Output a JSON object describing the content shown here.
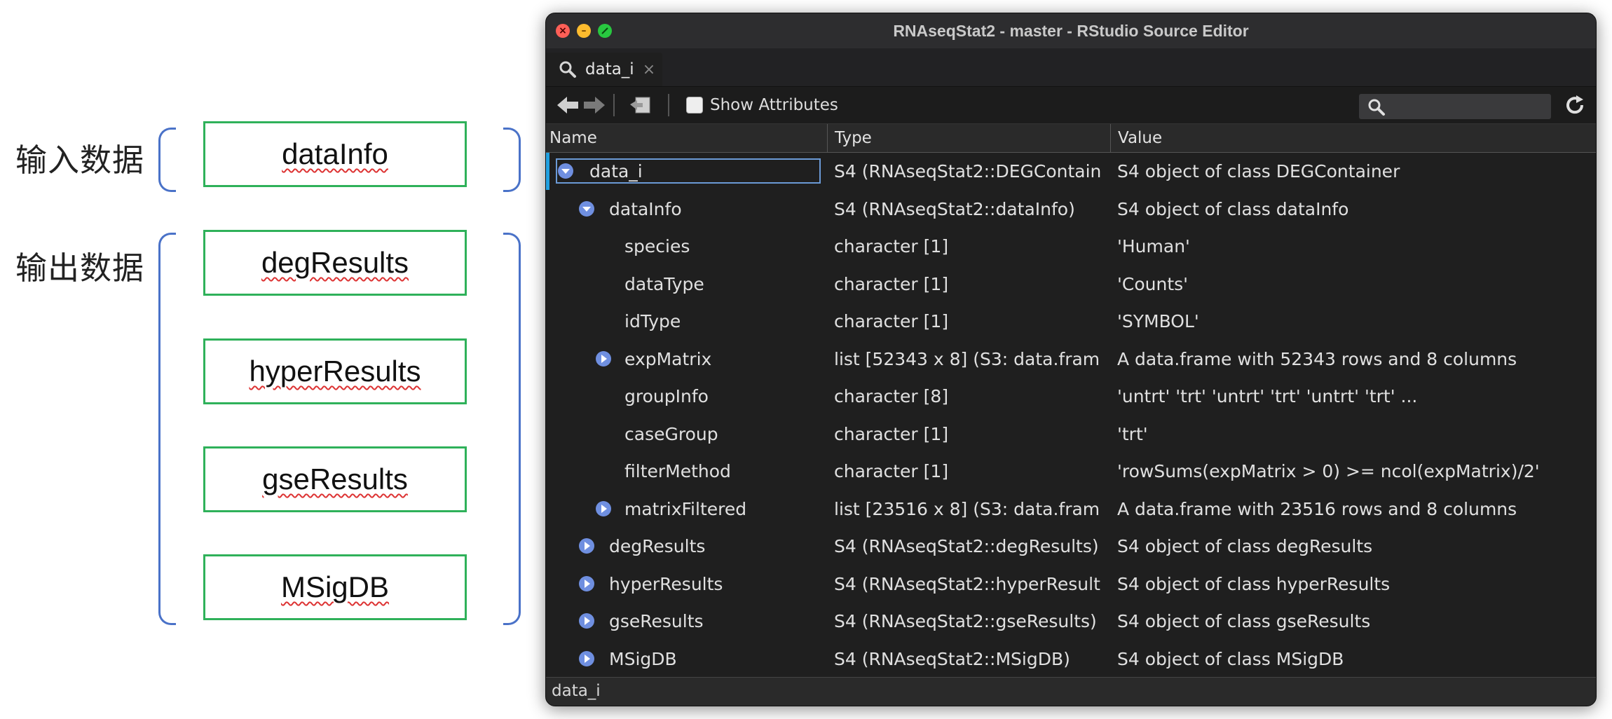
{
  "diagram": {
    "input_label": "输入数据",
    "output_label": "输出数据",
    "slots": [
      "dataInfo",
      "degResults",
      "hyperResults",
      "gseResults",
      "MSigDB"
    ]
  },
  "window": {
    "title": "RNAseqStat2 - master - RStudio Source Editor",
    "tab_label": "data_i",
    "show_attributes_label": "Show Attributes",
    "search_placeholder": "",
    "columns": [
      "Name",
      "Type",
      "Value"
    ],
    "rows": [
      {
        "name": "data_i",
        "type": "S4 (RNAseqStat2::DEGContain",
        "value": "S4 object of class DEGContainer",
        "toggle": "expanded",
        "level": 0
      },
      {
        "name": "dataInfo",
        "type": "S4 (RNAseqStat2::dataInfo)",
        "value": "S4 object of class dataInfo",
        "toggle": "expanded",
        "level": 1
      },
      {
        "name": "species",
        "type": "character [1]",
        "value": "'Human'",
        "toggle": "none",
        "level": 2
      },
      {
        "name": "dataType",
        "type": "character [1]",
        "value": "'Counts'",
        "toggle": "none",
        "level": 2
      },
      {
        "name": "idType",
        "type": "character [1]",
        "value": "'SYMBOL'",
        "toggle": "none",
        "level": 2
      },
      {
        "name": "expMatrix",
        "type": "list [52343 x 8] (S3: data.fram",
        "value": "A data.frame with 52343 rows and 8 columns",
        "toggle": "collapsed",
        "level": 2
      },
      {
        "name": "groupInfo",
        "type": "character [8]",
        "value": "'untrt' 'trt' 'untrt' 'trt' 'untrt' 'trt' ...",
        "toggle": "none",
        "level": 2
      },
      {
        "name": "caseGroup",
        "type": "character [1]",
        "value": "'trt'",
        "toggle": "none",
        "level": 2
      },
      {
        "name": "filterMethod",
        "type": "character [1]",
        "value": "'rowSums(expMatrix > 0) >= ncol(expMatrix)/2'",
        "toggle": "none",
        "level": 2
      },
      {
        "name": "matrixFiltered",
        "type": "list [23516 x 8] (S3: data.fram",
        "value": "A data.frame with 23516 rows and 8 columns",
        "toggle": "collapsed",
        "level": 2
      },
      {
        "name": "degResults",
        "type": "S4 (RNAseqStat2::degResults)",
        "value": "S4 object of class degResults",
        "toggle": "collapsed",
        "level": 1
      },
      {
        "name": "hyperResults",
        "type": "S4 (RNAseqStat2::hyperResult",
        "value": "S4 object of class hyperResults",
        "toggle": "collapsed",
        "level": 1
      },
      {
        "name": "gseResults",
        "type": "S4 (RNAseqStat2::gseResults)",
        "value": "S4 object of class gseResults",
        "toggle": "collapsed",
        "level": 1
      },
      {
        "name": "MSigDB",
        "type": "S4 (RNAseqStat2::MSigDB)",
        "value": "S4 object of class MSigDB",
        "toggle": "collapsed",
        "level": 1
      }
    ],
    "status_text": "data_i"
  }
}
